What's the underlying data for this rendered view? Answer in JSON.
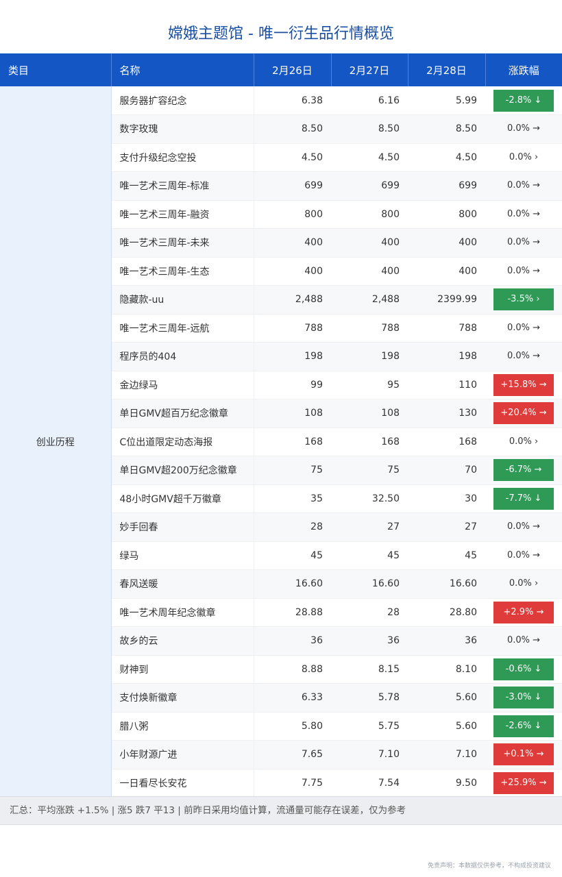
{
  "title": "嫦娥主题馆 - 唯一衍生品行情概览",
  "headers": {
    "category": "类目",
    "name": "名称",
    "d1": "2月26日",
    "d2": "2月27日",
    "d3": "2月28日",
    "change": "涨跌幅"
  },
  "category": "创业历程",
  "rows": [
    {
      "name": "服务器扩容纪念",
      "d1": "6.38",
      "d2": "6.16",
      "d3": "5.99",
      "change": "-2.8% ↓",
      "trend": "down"
    },
    {
      "name": "数字玫瑰",
      "d1": "8.50",
      "d2": "8.50",
      "d3": "8.50",
      "change": "0.0% →",
      "trend": "flat"
    },
    {
      "name": "支付升级纪念空投",
      "d1": "4.50",
      "d2": "4.50",
      "d3": "4.50",
      "change": "0.0% ›",
      "trend": "flat"
    },
    {
      "name": "唯一艺术三周年-标准",
      "d1": "699",
      "d2": "699",
      "d3": "699",
      "change": "0.0% →",
      "trend": "flat"
    },
    {
      "name": "唯一艺术三周年-融资",
      "d1": "800",
      "d2": "800",
      "d3": "800",
      "change": "0.0% →",
      "trend": "flat"
    },
    {
      "name": "唯一艺术三周年-未来",
      "d1": "400",
      "d2": "400",
      "d3": "400",
      "change": "0.0% →",
      "trend": "flat"
    },
    {
      "name": "唯一艺术三周年-生态",
      "d1": "400",
      "d2": "400",
      "d3": "400",
      "change": "0.0% →",
      "trend": "flat"
    },
    {
      "name": "隐藏款-uu",
      "d1": "2,488",
      "d2": "2,488",
      "d3": "2399.99",
      "change": "-3.5% ›",
      "trend": "down"
    },
    {
      "name": "唯一艺术三周年-远航",
      "d1": "788",
      "d2": "788",
      "d3": "788",
      "change": "0.0% →",
      "trend": "flat"
    },
    {
      "name": "程序员的404",
      "d1": "198",
      "d2": "198",
      "d3": "198",
      "change": "0.0% →",
      "trend": "flat"
    },
    {
      "name": "金边绿马",
      "d1": "99",
      "d2": "95",
      "d3": "110",
      "change": "+15.8% →",
      "trend": "up"
    },
    {
      "name": "单日GMV超百万纪念徽章",
      "d1": "108",
      "d2": "108",
      "d3": "130",
      "change": "+20.4% →",
      "trend": "up"
    },
    {
      "name": "C位出道限定动态海报",
      "d1": "168",
      "d2": "168",
      "d3": "168",
      "change": "0.0% ›",
      "trend": "flat"
    },
    {
      "name": "单日GMV超200万纪念徽章",
      "d1": "75",
      "d2": "75",
      "d3": "70",
      "change": "-6.7% →",
      "trend": "down"
    },
    {
      "name": "48小时GMV超千万徽章",
      "d1": "35",
      "d2": "32.50",
      "d3": "30",
      "change": "-7.7% ↓",
      "trend": "down"
    },
    {
      "name": "妙手回春",
      "d1": "28",
      "d2": "27",
      "d3": "27",
      "change": "0.0% →",
      "trend": "flat"
    },
    {
      "name": "绿马",
      "d1": "45",
      "d2": "45",
      "d3": "45",
      "change": "0.0% →",
      "trend": "flat"
    },
    {
      "name": "春风送暖",
      "d1": "16.60",
      "d2": "16.60",
      "d3": "16.60",
      "change": "0.0% ›",
      "trend": "flat"
    },
    {
      "name": "唯一艺术周年纪念徽章",
      "d1": "28.88",
      "d2": "28",
      "d3": "28.80",
      "change": "+2.9% →",
      "trend": "up"
    },
    {
      "name": "故乡的云",
      "d1": "36",
      "d2": "36",
      "d3": "36",
      "change": "0.0% →",
      "trend": "flat"
    },
    {
      "name": "财神到",
      "d1": "8.88",
      "d2": "8.15",
      "d3": "8.10",
      "change": "-0.6% ↓",
      "trend": "down"
    },
    {
      "name": "支付焕新徽章",
      "d1": "6.33",
      "d2": "5.78",
      "d3": "5.60",
      "change": "-3.0% ↓",
      "trend": "down"
    },
    {
      "name": "腊八粥",
      "d1": "5.80",
      "d2": "5.75",
      "d3": "5.60",
      "change": "-2.6% ↓",
      "trend": "down"
    },
    {
      "name": "小年财源广进",
      "d1": "7.65",
      "d2": "7.10",
      "d3": "7.10",
      "change": "+0.1% →",
      "trend": "up"
    },
    {
      "name": "一日看尽长安花",
      "d1": "7.75",
      "d2": "7.54",
      "d3": "9.50",
      "change": "+25.9% →",
      "trend": "up"
    }
  ],
  "summary": "汇总：平均涨跌 +1.5% | 涨5 跌7 平13 | 前昨日采用均值计算，流通量可能存在误差，仅为参考",
  "disclaimer": "免责声明：本数据仅供参考，不构成投资建议",
  "colors": {
    "header": "#1556c5",
    "down": "#2e9a55",
    "up": "#e03b3b",
    "title": "#1a4fa3"
  }
}
